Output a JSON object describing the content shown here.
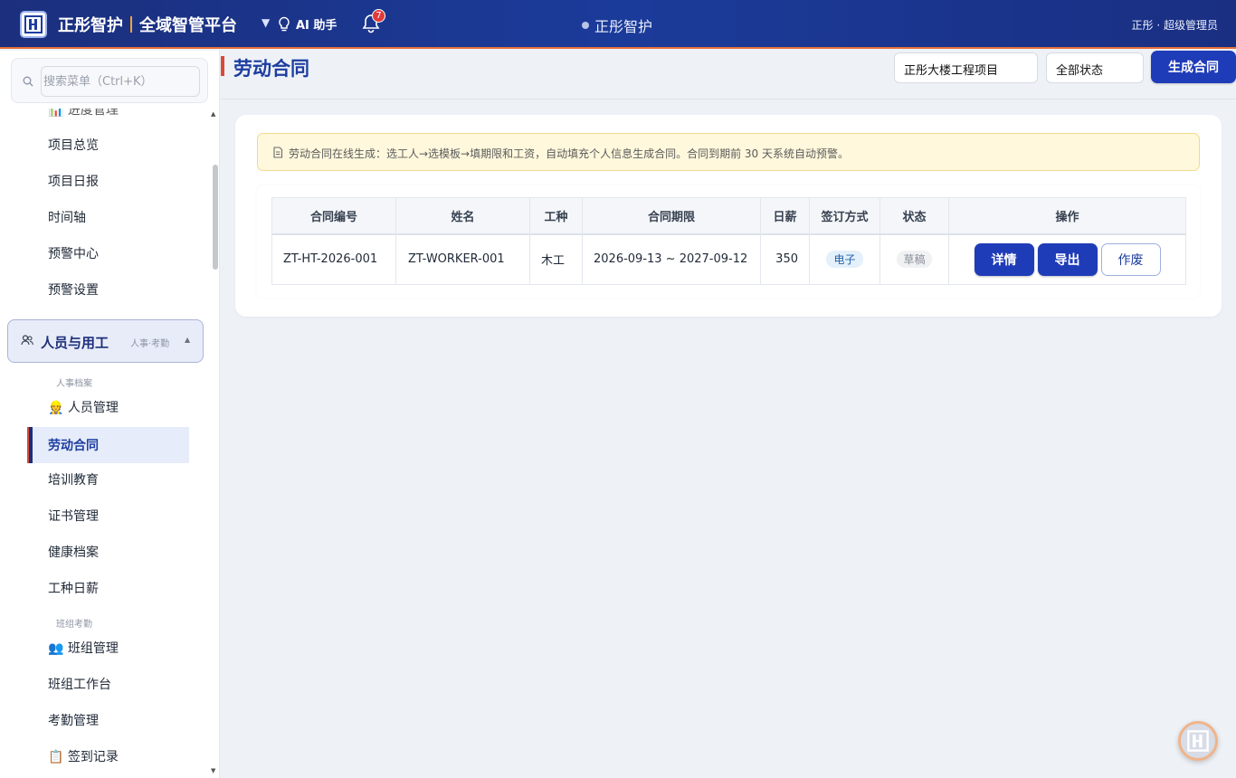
{
  "header": {
    "brand_name": "正彤智护",
    "platform_name": "全域智管平台",
    "ai_assistant_label": "AI 助手",
    "notification_count": "7",
    "center_title": "正彤智护",
    "user_label": "正彤 · 超级管理员"
  },
  "sidebar": {
    "search_placeholder": "搜索菜单（Ctrl+K）",
    "cut_item_label": "进度管理",
    "top_items": [
      "项目总览",
      "项目日报",
      "时间轴",
      "预警中心",
      "预警设置"
    ],
    "group": {
      "label": "人员与用工",
      "sub": "人事·考勤"
    },
    "section_hr": "人事档案",
    "hr_items": [
      "👷 人员管理",
      "劳动合同",
      "培训教育",
      "证书管理",
      "健康档案",
      "工种日薪"
    ],
    "section_team": "班组考勤",
    "team_items": [
      "👥 班组管理",
      "班组工作台",
      "考勤管理",
      "📋 签到记录"
    ],
    "active_item": "劳动合同"
  },
  "main": {
    "page_title": "劳动合同",
    "project_select": "正彤大楼工程项目",
    "status_select": "全部状态",
    "generate_button": "生成合同",
    "notice": "劳动合同在线生成：选工人→选模板→填期限和工资，自动填充个人信息生成合同。合同到期前 30 天系统自动预警。",
    "table": {
      "columns": [
        "合同编号",
        "姓名",
        "工种",
        "合同期限",
        "日薪",
        "签订方式",
        "状态",
        "操作"
      ],
      "rows": [
        {
          "contract_no": "ZT-HT-2026-001",
          "name": "ZT-WORKER-001",
          "trade": "木工",
          "period": "2026-09-13 ~ 2027-09-12",
          "daily_wage": "350",
          "sign_method": "电子",
          "status": "草稿",
          "actions": {
            "detail": "详情",
            "export": "导出",
            "void": "作废"
          }
        }
      ]
    }
  },
  "colors": {
    "header_bg": "#1b3b9a",
    "accent": "#1f3cb8",
    "header_border": "#e8703a",
    "notice_bg": "#fff8dc"
  }
}
